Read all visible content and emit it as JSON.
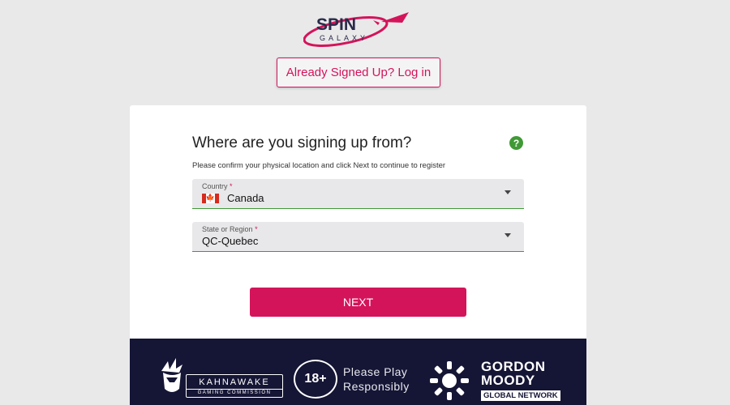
{
  "header": {
    "logo": {
      "brand_top": "SPIN",
      "brand_bottom": "GALAXY",
      "brand_color": "#d4145a",
      "icon": "rocket-icon"
    },
    "login_label": "Already Signed Up? Log in"
  },
  "form": {
    "title": "Where are you signing up from?",
    "help_icon": "?",
    "subtitle": "Please confirm your physical location and click Next to continue to register",
    "country": {
      "label": "Country",
      "required": "*",
      "value": "Canada",
      "flag": "canada-flag-icon"
    },
    "region": {
      "label": "State or Region",
      "required": "*",
      "value": "QC-Quebec"
    },
    "next_label": "NEXT"
  },
  "footer": {
    "kahnawake_name": "KAHNAWAKE",
    "kahnawake_sub": "GAMING COMMISSION",
    "age_badge": "18+",
    "play_line1": "Please Play",
    "play_line2": "Responsibly",
    "gordon_line1": "GORDON",
    "gordon_line2": "MOODY",
    "gordon_badge": "GLOBAL NETWORK",
    "background": "#151535"
  },
  "colors": {
    "accent": "#d4145a",
    "success": "#3f9a35",
    "page_bg": "#e9e9ea"
  }
}
